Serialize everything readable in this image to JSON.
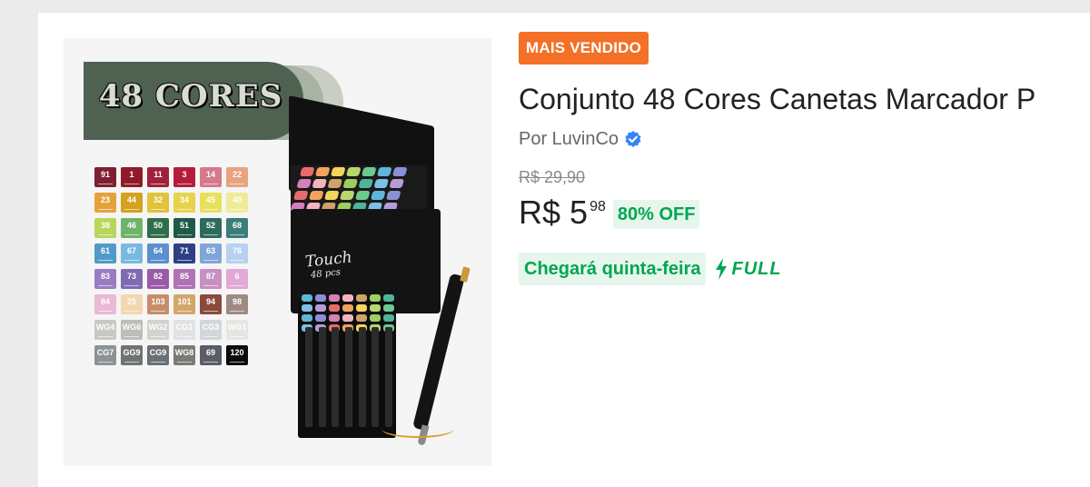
{
  "image": {
    "banner_text": "48 CORES",
    "box_brand": "Touch",
    "box_sub": "48 pcs",
    "swatch_rows": [
      [
        {
          "code": "91",
          "color": "#7d1f2f"
        },
        {
          "code": "1",
          "color": "#8f1b2a"
        },
        {
          "code": "11",
          "color": "#a0223a"
        },
        {
          "code": "3",
          "color": "#b31c3b"
        },
        {
          "code": "14",
          "color": "#d47a8a"
        },
        {
          "code": "22",
          "color": "#e8a37f"
        }
      ],
      [
        {
          "code": "23",
          "color": "#e6a23a"
        },
        {
          "code": "44",
          "color": "#d4a21f"
        },
        {
          "code": "32",
          "color": "#e0c23b"
        },
        {
          "code": "34",
          "color": "#e8d24b"
        },
        {
          "code": "45",
          "color": "#e8e05c"
        },
        {
          "code": "40",
          "color": "#f0ec95"
        }
      ],
      [
        {
          "code": "38",
          "color": "#b9d65b"
        },
        {
          "code": "46",
          "color": "#6fb26a"
        },
        {
          "code": "50",
          "color": "#2f6e4b"
        },
        {
          "code": "51",
          "color": "#1f5a48"
        },
        {
          "code": "52",
          "color": "#2d6b5c"
        },
        {
          "code": "68",
          "color": "#3c7d7a"
        }
      ],
      [
        {
          "code": "61",
          "color": "#4f9bc8"
        },
        {
          "code": "67",
          "color": "#78b9e0"
        },
        {
          "code": "64",
          "color": "#5b8fcd"
        },
        {
          "code": "71",
          "color": "#2f3f86"
        },
        {
          "code": "63",
          "color": "#7fa6d6"
        },
        {
          "code": "76",
          "color": "#b7d1ee"
        }
      ],
      [
        {
          "code": "83",
          "color": "#9a7cc4"
        },
        {
          "code": "73",
          "color": "#7e6bb4"
        },
        {
          "code": "82",
          "color": "#9a5aa6"
        },
        {
          "code": "85",
          "color": "#b072b4"
        },
        {
          "code": "87",
          "color": "#c78fc4"
        },
        {
          "code": "6",
          "color": "#e2a8d6"
        }
      ],
      [
        {
          "code": "84",
          "color": "#e9b9d6"
        },
        {
          "code": "25",
          "color": "#f2d7b0"
        },
        {
          "code": "103",
          "color": "#c78d6b"
        },
        {
          "code": "101",
          "color": "#d4a66a"
        },
        {
          "code": "94",
          "color": "#8a4a3c"
        },
        {
          "code": "98",
          "color": "#9e8a85"
        }
      ],
      [
        {
          "code": "WG4",
          "color": "#c8c8c4"
        },
        {
          "code": "WG6",
          "color": "#bebdb8"
        },
        {
          "code": "WG2",
          "color": "#d3d2ce"
        },
        {
          "code": "CG1",
          "color": "#e0e2e3"
        },
        {
          "code": "CG3",
          "color": "#d3d6d8"
        },
        {
          "code": "WG1",
          "color": "#e6e5e1"
        }
      ],
      [
        {
          "code": "CG7",
          "color": "#8c9296"
        },
        {
          "code": "GG9",
          "color": "#6f7472"
        },
        {
          "code": "CG9",
          "color": "#6a7075"
        },
        {
          "code": "WG8",
          "color": "#7b7a74"
        },
        {
          "code": "69",
          "color": "#5a5c66"
        },
        {
          "code": "120",
          "color": "#0b0b0b"
        }
      ]
    ],
    "cap_colors": [
      "#e86b6b",
      "#f2a25c",
      "#f5d45c",
      "#b8d66b",
      "#6cc98f",
      "#5fb6d9",
      "#8b8fd6",
      "#d67fb9",
      "#f3b4c2",
      "#cfa26b",
      "#9ccf5f",
      "#4fb59a",
      "#7cc0e8",
      "#b69ad9"
    ]
  },
  "badge": "MAIS VENDIDO",
  "title": "Conjunto 48 Cores Canetas Marcador P",
  "seller": "Por LuvinCo",
  "old_price": "R$ 29,90",
  "price": {
    "currency": "R$",
    "integer": "5",
    "cents": "98"
  },
  "discount": "80% OFF",
  "delivery": "Chegará quinta-feira",
  "shipping": "FULL",
  "colors": {
    "badge": "#f37026",
    "accent_green": "#00a650",
    "green_bg": "#e7f6ec",
    "verified_blue": "#3483fa"
  }
}
